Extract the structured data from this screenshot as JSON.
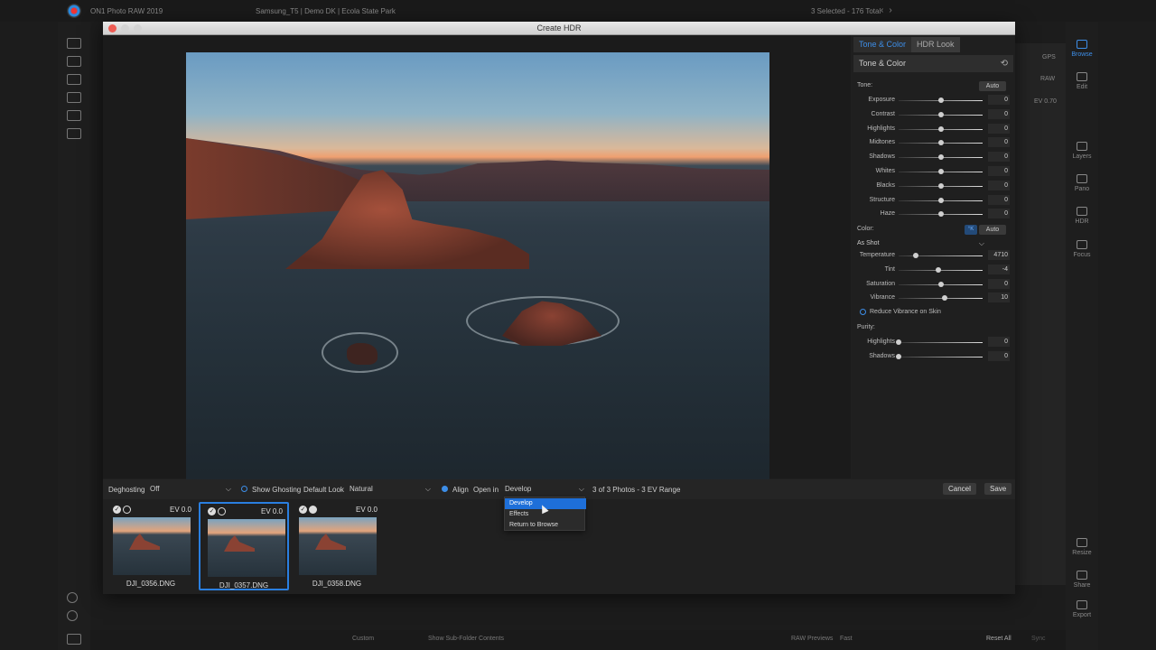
{
  "app": {
    "name": "ON1 Photo RAW 2019",
    "breadcrumb": "Samsung_T5 | Demo DK | Ecola State Park",
    "selection": "3 Selected - 176 Total",
    "bg_gps": "GPS",
    "bg_raw": "RAW",
    "bg_ev": "EV 0.70"
  },
  "right_rail": {
    "items": [
      "Browse",
      "Edit",
      "Layers",
      "Pano",
      "HDR",
      "Focus",
      "Resize",
      "Share",
      "Export"
    ]
  },
  "app_bottom": {
    "sort": "Custom",
    "subfolder": "Show Sub-Folder Contents",
    "raw_previews_label": "RAW Previews",
    "raw_previews_value": "Fast",
    "reset_all": "Reset All",
    "sync": "Sync"
  },
  "dialog": {
    "title": "Create HDR",
    "tabs": [
      "Tone & Color",
      "HDR Look"
    ],
    "section_title": "Tone & Color",
    "tone_label": "Tone:",
    "auto_label": "Auto",
    "tone_sliders": [
      {
        "name": "Exposure",
        "value": "0",
        "pos": 0.5
      },
      {
        "name": "Contrast",
        "value": "0",
        "pos": 0.5
      },
      {
        "name": "Highlights",
        "value": "0",
        "pos": 0.5
      },
      {
        "name": "Midtones",
        "value": "0",
        "pos": 0.5
      },
      {
        "name": "Shadows",
        "value": "0",
        "pos": 0.5
      },
      {
        "name": "Whites",
        "value": "0",
        "pos": 0.5
      },
      {
        "name": "Blacks",
        "value": "0",
        "pos": 0.5
      },
      {
        "name": "Structure",
        "value": "0",
        "pos": 0.5
      },
      {
        "name": "Haze",
        "value": "0",
        "pos": 0.5
      }
    ],
    "color_label": "Color:",
    "kelvin_badge": "°K",
    "white_balance": "As Shot",
    "color_sliders": [
      {
        "name": "Temperature",
        "value": "4710",
        "pos": 0.2
      },
      {
        "name": "Tint",
        "value": "-4",
        "pos": 0.47
      },
      {
        "name": "Saturation",
        "value": "0",
        "pos": 0.5
      },
      {
        "name": "Vibrance",
        "value": "10",
        "pos": 0.55
      }
    ],
    "reduce_vibrance": "Reduce Vibrance on Skin",
    "purity_label": "Purity:",
    "purity_sliders": [
      {
        "name": "Highlights",
        "value": "0",
        "pos": 0.0
      },
      {
        "name": "Shadows",
        "value": "0",
        "pos": 0.0
      }
    ],
    "toolbar": {
      "deghosting_label": "Deghosting",
      "deghosting_value": "Off",
      "show_ghosting": "Show Ghosting",
      "default_look_label": "Default Look",
      "default_look_value": "Natural",
      "align": "Align",
      "open_in_label": "Open in",
      "open_in_value": "Develop",
      "range_info": "3 of 3 Photos - 3 EV Range",
      "cancel": "Cancel",
      "save": "Save"
    },
    "open_in_menu": [
      "Develop",
      "Effects",
      "Return to Browse"
    ],
    "thumbnails": [
      {
        "file": "DJI_0356.DNG",
        "ev": "EV 0.0"
      },
      {
        "file": "DJI_0357.DNG",
        "ev": "EV 0.0"
      },
      {
        "file": "DJI_0358.DNG",
        "ev": "EV 0.0"
      }
    ]
  }
}
